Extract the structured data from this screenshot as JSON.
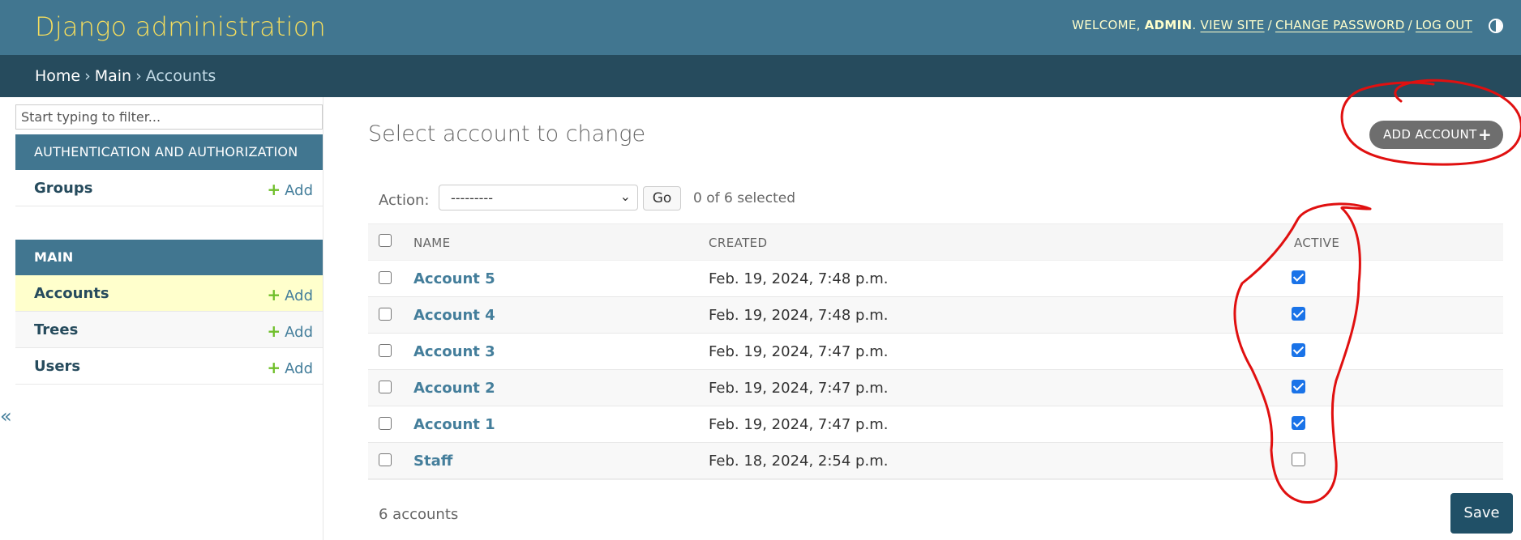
{
  "header": {
    "branding": "Django administration",
    "welcome": "Welcome,",
    "user": "admin",
    "view_site": "View site",
    "change_password": "Change password",
    "log_out": "Log out",
    "theme_icon": "theme-toggle-icon"
  },
  "breadcrumbs": {
    "home": "Home",
    "separator": "›",
    "app": "Main",
    "current": "Accounts"
  },
  "sidebar": {
    "filter_placeholder": "Start typing to filter...",
    "toggle": "«",
    "apps": [
      {
        "caption": "Authentication and Authorization",
        "models": [
          {
            "label": "Groups",
            "add": "Add"
          }
        ]
      },
      {
        "caption": "Main",
        "models": [
          {
            "label": "Accounts",
            "add": "Add"
          },
          {
            "label": "Trees",
            "add": "Add"
          },
          {
            "label": "Users",
            "add": "Add"
          }
        ]
      }
    ]
  },
  "content": {
    "title": "Select account to change",
    "add_button": "Add Account",
    "action_label": "Action:",
    "action_selected": "---------",
    "go_button": "Go",
    "counter": "0 of 6 selected",
    "columns": [
      "Name",
      "Created",
      "Active"
    ],
    "rows": [
      {
        "name": "Account 5",
        "created": "Feb. 19, 2024, 7:48 p.m.",
        "active": true
      },
      {
        "name": "Account 4",
        "created": "Feb. 19, 2024, 7:48 p.m.",
        "active": true
      },
      {
        "name": "Account 3",
        "created": "Feb. 19, 2024, 7:47 p.m.",
        "active": true
      },
      {
        "name": "Account 2",
        "created": "Feb. 19, 2024, 7:47 p.m.",
        "active": true
      },
      {
        "name": "Account 1",
        "created": "Feb. 19, 2024, 7:47 p.m.",
        "active": true
      },
      {
        "name": "Staff",
        "created": "Feb. 18, 2024, 2:54 p.m.",
        "active": false
      }
    ],
    "paginator": "6 accounts",
    "save_button": "Save"
  },
  "colors": {
    "header_bg": "#417690",
    "breadcrumb_bg": "#264b5d",
    "branding": "#f5dd5d",
    "link": "#447e9b",
    "add_green": "#70bf2b",
    "annotation_red": "#e01010"
  }
}
